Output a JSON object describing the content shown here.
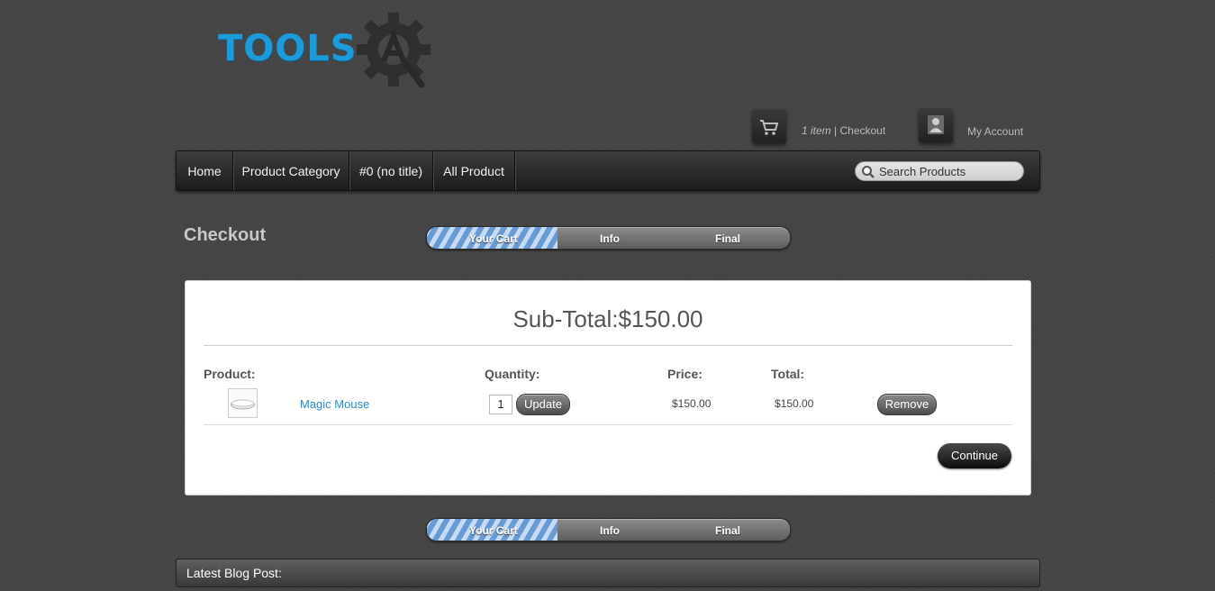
{
  "brand": {
    "logo_text": "TOOLS"
  },
  "header": {
    "cart_items": "1 item",
    "cart_sep": " | ",
    "checkout_link": "Checkout",
    "account_link": "My Account"
  },
  "nav": {
    "items": [
      {
        "label": "Home"
      },
      {
        "label": "Product Category"
      },
      {
        "label": "#0 (no title)"
      },
      {
        "label": "All Product"
      }
    ],
    "search_placeholder": "Search Products"
  },
  "page": {
    "title": "Checkout"
  },
  "steps": {
    "labels": [
      "Your Cart",
      "Info",
      "Final"
    ],
    "active": "Your Cart"
  },
  "cart": {
    "subtotal": "Sub-Total:$150.00",
    "headers": {
      "product": "Product:",
      "quantity": "Quantity:",
      "price": "Price:",
      "total": "Total:"
    },
    "items": [
      {
        "name": "Magic Mouse",
        "quantity": "1",
        "price": "$150.00",
        "total": "$150.00"
      }
    ],
    "update_label": "Update",
    "remove_label": "Remove",
    "continue_label": "Continue"
  },
  "blog": {
    "title": "Latest Blog Post:"
  },
  "colors": {
    "accent": "#1f9ad8",
    "link": "#2b8ccb",
    "background": "#454545"
  }
}
